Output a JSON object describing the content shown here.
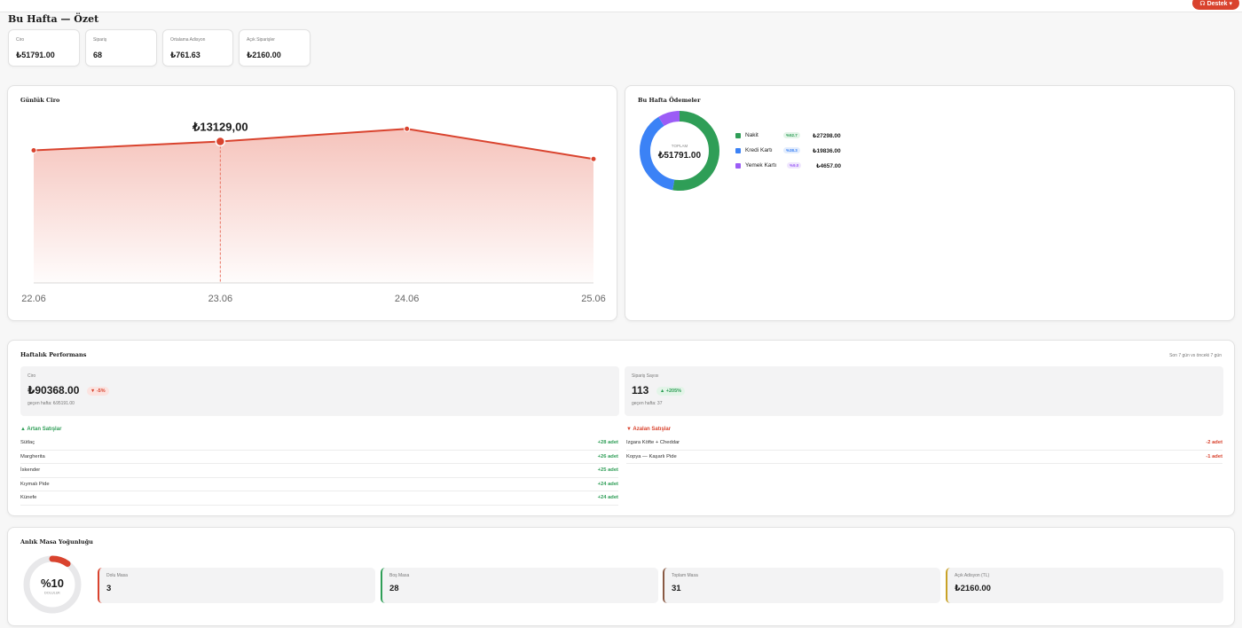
{
  "header": {
    "support_label": "Destek"
  },
  "page": {
    "title": "Bu Hafta — Özet"
  },
  "kpis": [
    {
      "label": "Ciro",
      "value": "₺51791.00"
    },
    {
      "label": "Sipariş",
      "value": "68"
    },
    {
      "label": "Ortalama Adisyon",
      "value": "₺761.63"
    },
    {
      "label": "Açık Siparişler",
      "value": "₺2160.00"
    }
  ],
  "daily_chart": {
    "title": "Günlük Ciro",
    "tooltip_value": "₺13129,00",
    "highlight_index": 1
  },
  "chart_data": {
    "type": "area",
    "categories": [
      "22.06",
      "23.06",
      "24.06",
      "25.06"
    ],
    "values": [
      12300,
      13129,
      14300,
      11500
    ],
    "ylim": [
      0,
      15800
    ]
  },
  "payments": {
    "title": "Bu Hafta Ödemeler",
    "center_label": "TOPLAM",
    "center_value": "₺51791.00",
    "items": [
      {
        "name": "Nakit",
        "pct": "%52.7",
        "amount": "₺27298.00",
        "fraction": 0.527,
        "color": "#2f9e57",
        "pct_bg": "#e3f4e8",
        "pct_fg": "#2f9e57"
      },
      {
        "name": "Kredi Kartı",
        "pct": "%38.3",
        "amount": "₺19836.00",
        "fraction": 0.383,
        "color": "#3b82f6",
        "pct_bg": "#e3edfd",
        "pct_fg": "#3b82f6"
      },
      {
        "name": "Yemek Kartı",
        "pct": "%9.0",
        "amount": "₺4657.00",
        "fraction": 0.09,
        "color": "#9b5cf6",
        "pct_bg": "#efe6fd",
        "pct_fg": "#9b5cf6"
      }
    ]
  },
  "performance": {
    "title": "Haftalık Performans",
    "subtitle": "Son 7 gün vs önceki 7 gün",
    "revenue": {
      "label": "Ciro",
      "value": "₺90368.00",
      "change": "▼ -5%",
      "prev": "geçen hafta: ₺95191.00"
    },
    "orders": {
      "label": "Sipariş Sayısı",
      "value": "113",
      "change": "▲ +205%",
      "prev": "geçen hafta: 37"
    },
    "rising_title": "▲ Artan Satışlar",
    "rising": [
      {
        "name": "Sütlaç",
        "qty": "+28 adet"
      },
      {
        "name": "Margherita",
        "qty": "+26 adet"
      },
      {
        "name": "İskender",
        "qty": "+25 adet"
      },
      {
        "name": "Kıymalı Pide",
        "qty": "+24 adet"
      },
      {
        "name": "Künefe",
        "qty": "+24 adet"
      }
    ],
    "falling_title": "▼ Azalan Satışlar",
    "falling": [
      {
        "name": "Izgara Köfte + Cheddar",
        "qty": "-2 adet"
      },
      {
        "name": "Kopya — Kaşarlı Pide",
        "qty": "-1 adet"
      }
    ]
  },
  "occupancy": {
    "title": "Anlık Masa Yoğunluğu",
    "percent_label": "%10",
    "sub_label": "DOLULUK",
    "fraction": 0.1,
    "boxes": [
      {
        "label": "Dolu Masa",
        "value": "3",
        "color": "#d9432e"
      },
      {
        "label": "Boş Masa",
        "value": "28",
        "color": "#2f9e57"
      },
      {
        "label": "Toplam Masa",
        "value": "31",
        "color": "#8a5a44"
      },
      {
        "label": "Açık Adisyon (TL)",
        "value": "₺2160.00",
        "color": "#c9a227"
      }
    ]
  },
  "colors": {
    "accent": "#d9432e",
    "positive": "#2f9e57",
    "negative": "#d9432e"
  }
}
